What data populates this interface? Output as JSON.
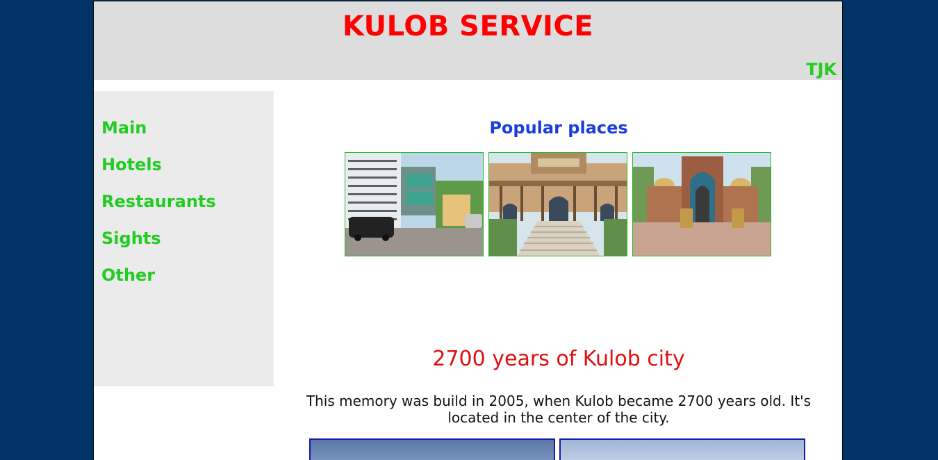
{
  "header": {
    "site_title": "KULOB SERVICE",
    "lang_label": "TJK"
  },
  "sidebar": {
    "items": [
      {
        "label": "Main"
      },
      {
        "label": "Hotels"
      },
      {
        "label": "Restaurants"
      },
      {
        "label": "Sights"
      },
      {
        "label": "Other"
      }
    ]
  },
  "main": {
    "popular_title": "Popular places",
    "thumbnails": [
      {
        "subject": "hotel building with parked car"
      },
      {
        "subject": "ornate building with stairs"
      },
      {
        "subject": "domed monument"
      }
    ],
    "city_title": "2700 years of Kulob city",
    "description": "This memory was build in 2005, when Kulob became 2700 years old. It's located in the center of the city."
  },
  "colors": {
    "background": "#003366",
    "title_red": "#ff0000",
    "nav_green": "#22cc22",
    "section_blue": "#1a3de0"
  }
}
